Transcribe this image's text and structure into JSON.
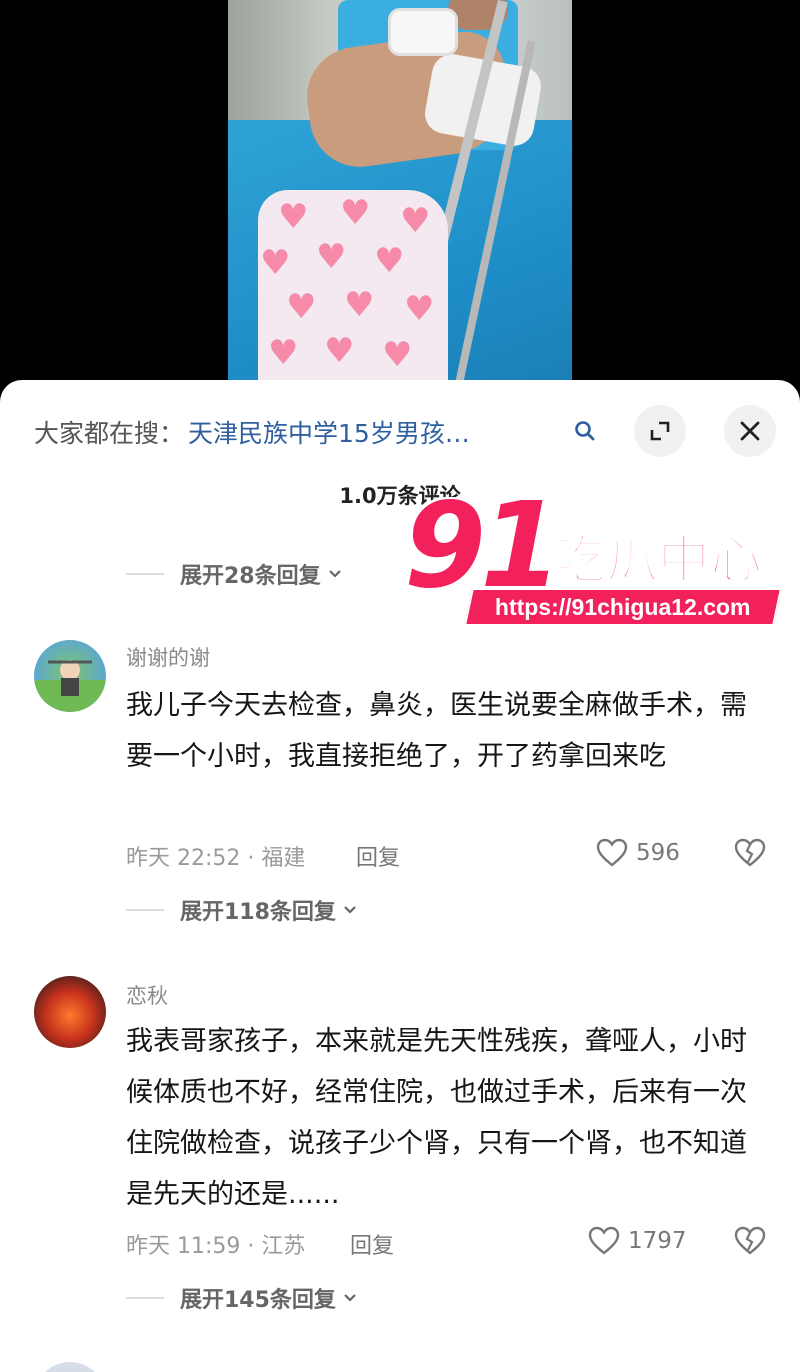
{
  "search_bar": {
    "prefix": "大家都在搜：",
    "term": "天津民族中学15岁男孩…"
  },
  "header": {
    "comment_count": "1.0万条评论"
  },
  "expand_replies_top": "展开28条回复",
  "comments": [
    {
      "username": "谢谢的谢",
      "content": "我儿子今天去检查，鼻炎，医生说要全麻做手术，需要一个小时，我直接拒绝了，开了药拿回来吃",
      "time_location": "昨天 22:52 · 福建",
      "reply_label": "回复",
      "likes": "596",
      "expand_replies": "展开118条回复"
    },
    {
      "username": "恋秋",
      "content": "我表哥家孩子，本来就是先天性残疾，聋哑人，小时候体质也不好，经常住院，也做过手术，后来有一次住院做检查，说孩子少个肾，只有一个肾，也不知道是先天的还是......",
      "time_location": "昨天 11:59 · 江苏",
      "reply_label": "回复",
      "likes": "1797",
      "expand_replies": "展开145条回复"
    }
  ],
  "watermark": {
    "number": "91",
    "title": "吃瓜中心",
    "url": "https://91chigua12.com"
  },
  "colors": {
    "search_term": "#2f5f9e",
    "watermark": "#f2215b"
  },
  "icons": [
    "search-icon",
    "expand-icon",
    "close-icon",
    "chevron-down-icon",
    "heart-icon",
    "broken-heart-icon"
  ]
}
